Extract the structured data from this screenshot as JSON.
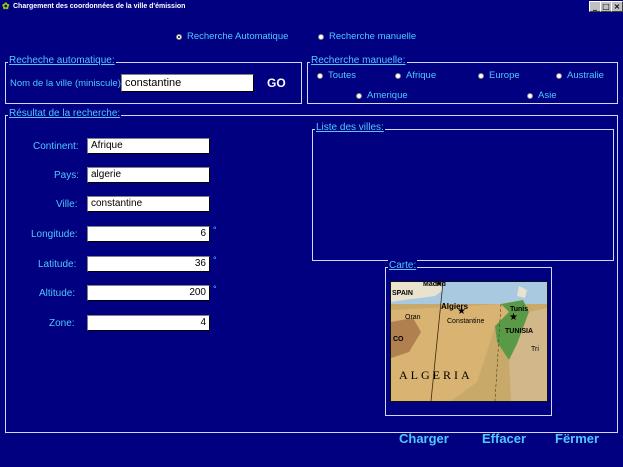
{
  "window": {
    "title": "Chargement des coordonnées de la ville d'émission",
    "controls": {
      "minimize": "_",
      "maximize": "□",
      "close": "×"
    }
  },
  "mode": {
    "auto_label": "Recherche Automatique",
    "manual_label": "Recherche manuelle",
    "selected": "auto"
  },
  "auto_search": {
    "group_title": "Recheche automatique:",
    "city_label": "Nom de la ville (miniscule):",
    "city_value": "constantine",
    "go_label": "GO"
  },
  "manual_search": {
    "group_title": "Recherche manuelle:",
    "options": [
      "Toutes",
      "Afrique",
      "Europe",
      "Australie",
      "Amerique",
      "Asie"
    ]
  },
  "result": {
    "group_title": "Résultat de la recherche:",
    "fields": {
      "continent": {
        "label": "Continent:",
        "value": "Afrique"
      },
      "pays": {
        "label": "Pays:",
        "value": "algerie"
      },
      "ville": {
        "label": "Ville:",
        "value": "constantine"
      },
      "longitude": {
        "label": "Longitude:",
        "value": "6",
        "unit": "°"
      },
      "latitude": {
        "label": "Latitude:",
        "value": "36",
        "unit": "°"
      },
      "altitude": {
        "label": "Altitude:",
        "value": "200",
        "unit": "°"
      },
      "zone": {
        "label": "Zone:",
        "value": "4"
      }
    },
    "cities_list_title": "Liste des villes:",
    "map_title": "Carte:",
    "map_labels": {
      "madrid": "Madrid",
      "spain": "SPAIN",
      "algiers": "Algiers",
      "tunis": "Tunis",
      "oran": "Oran",
      "constantine": "Constantine",
      "tunisia": "TUNISIA",
      "algeria": "ALGERIA",
      "co": "CO",
      "tri": "Tri"
    }
  },
  "actions": {
    "charger": "Charger",
    "effacer": "Effacer",
    "fermer": "Fërmer"
  },
  "colors": {
    "background": "#000080",
    "label": "#4fc8ff",
    "border": "#cfd7ff"
  }
}
